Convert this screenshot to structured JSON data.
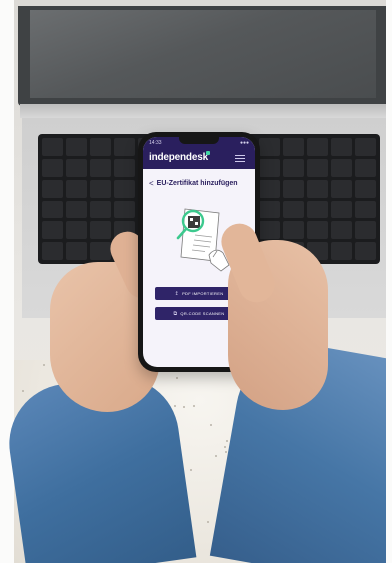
{
  "photo": {
    "subject": "hands-holding-phone-over-laptop"
  },
  "phone": {
    "status_time": "14:33",
    "status_right": "●●●",
    "brand": "independesk",
    "brand_accent_color": "#3fd6a4",
    "header_color": "#2a1f5e",
    "back_glyph": "<",
    "page_title": "EU-Zertifikat hinzufügen",
    "buttons": [
      {
        "label": "PDF IMPORTIEREN",
        "icon": "upload-icon",
        "glyph": "↥"
      },
      {
        "label": "QR-CODE SCANNEN",
        "icon": "qr-scan-icon",
        "glyph": "⧉"
      }
    ],
    "button_color": "#2f2468"
  }
}
